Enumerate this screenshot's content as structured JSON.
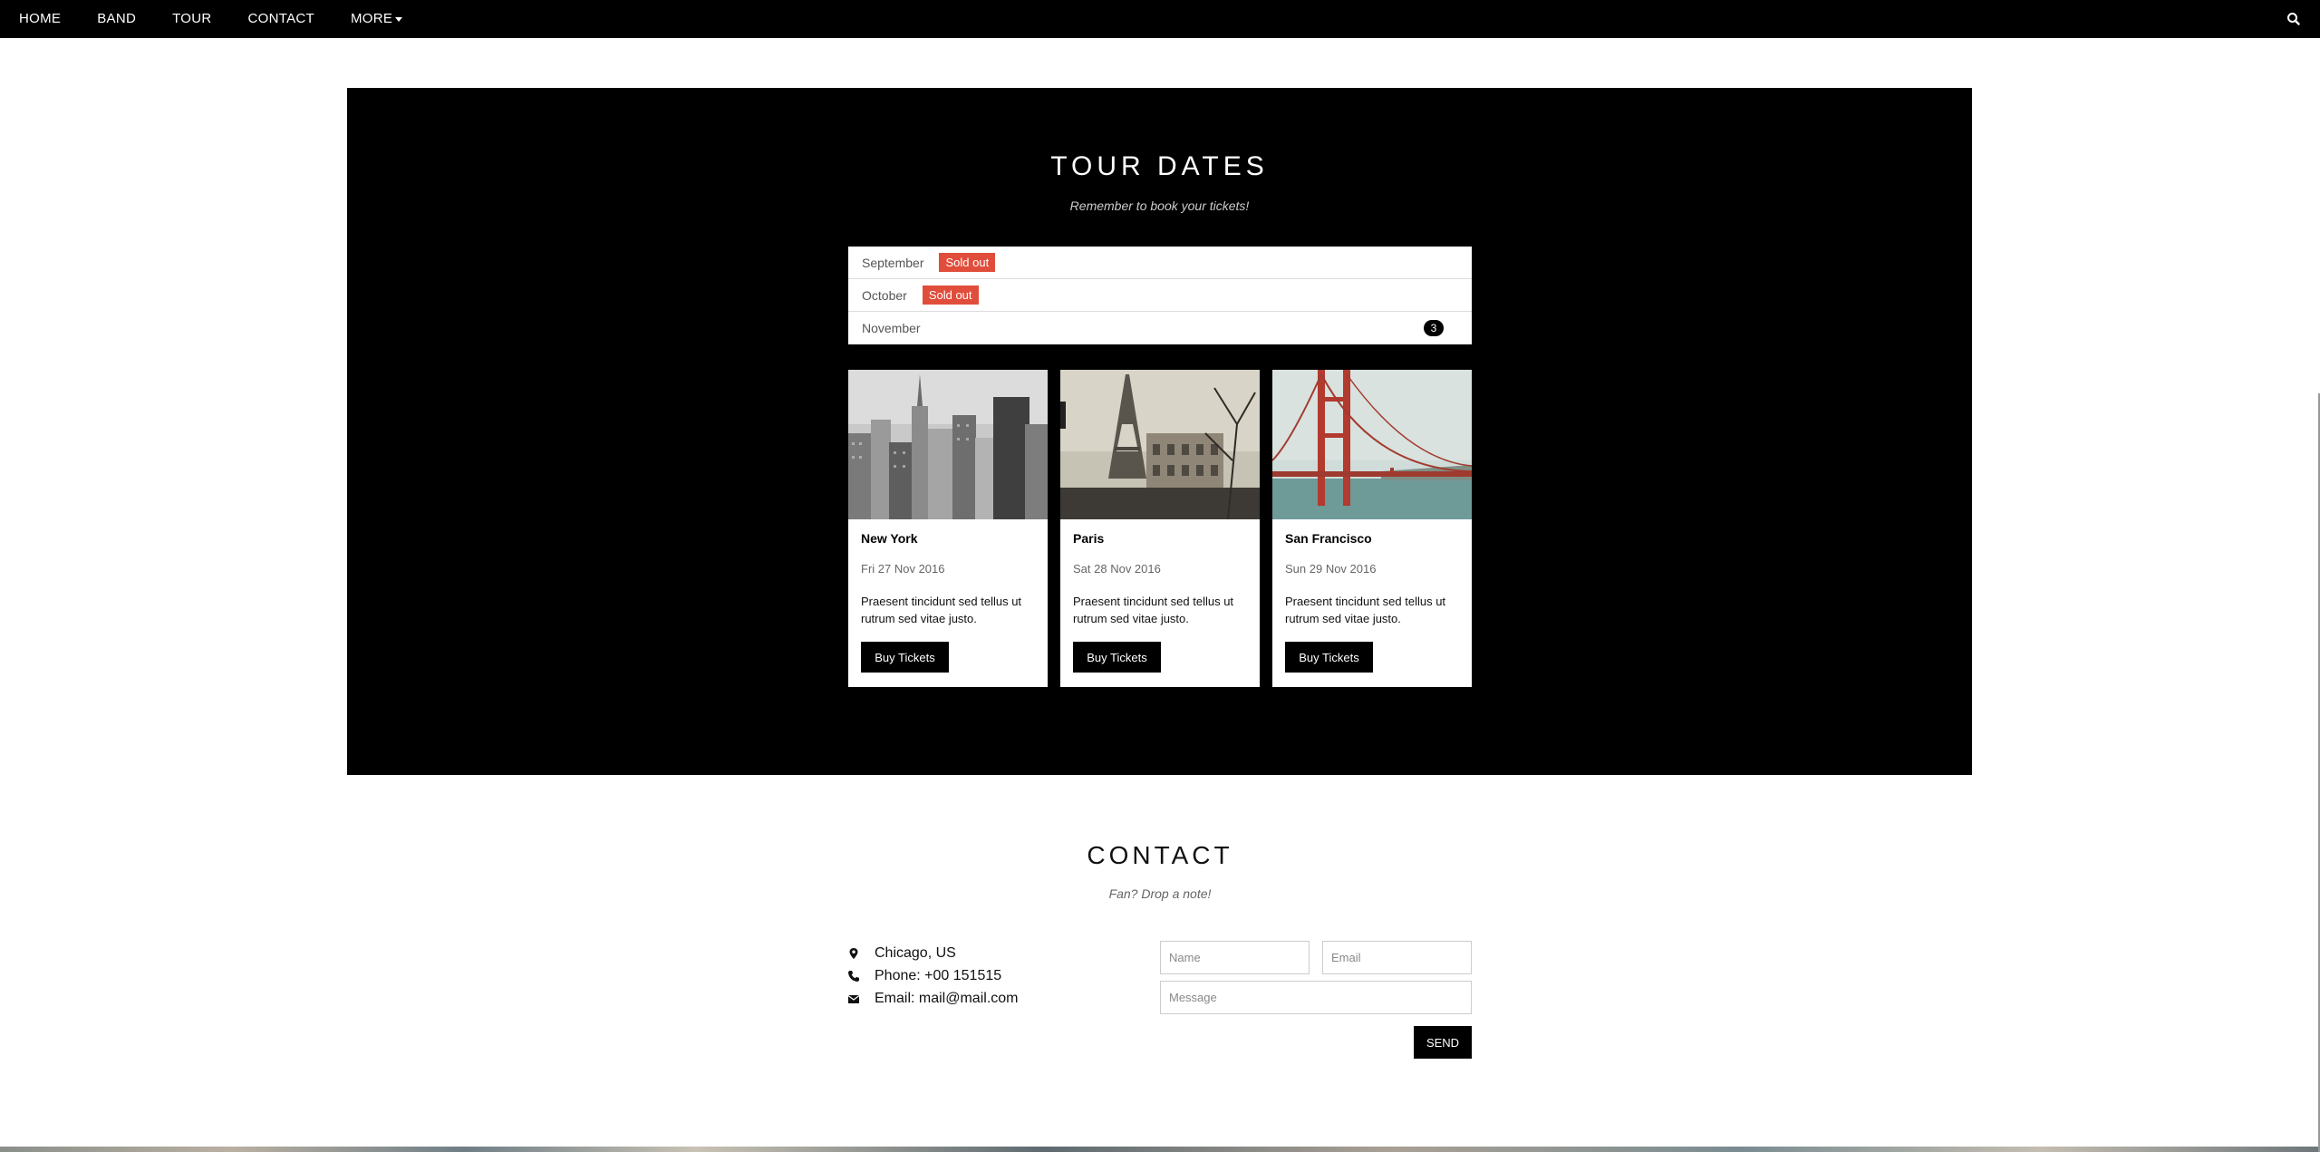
{
  "nav": {
    "items": [
      "HOME",
      "BAND",
      "TOUR",
      "CONTACT"
    ],
    "more_label": "MORE",
    "search_icon": "search-icon"
  },
  "tour": {
    "title": "TOUR DATES",
    "subtitle": "Remember to book your tickets!",
    "months": [
      {
        "name": "September",
        "badge": "Sold out"
      },
      {
        "name": "October",
        "badge": "Sold out"
      },
      {
        "name": "November",
        "count": "3"
      }
    ],
    "cards": [
      {
        "city": "New York",
        "date": "Fri 27 Nov 2016",
        "desc": "Praesent tincidunt sed tellus ut rutrum sed vitae justo.",
        "button": "Buy Tickets"
      },
      {
        "city": "Paris",
        "date": "Sat 28 Nov 2016",
        "desc": "Praesent tincidunt sed tellus ut rutrum sed vitae justo.",
        "button": "Buy Tickets"
      },
      {
        "city": "San Francisco",
        "date": "Sun 29 Nov 2016",
        "desc": "Praesent tincidunt sed tellus ut rutrum sed vitae justo.",
        "button": "Buy Tickets"
      }
    ],
    "colors": {
      "sold_out": "#e04d3b",
      "background": "#000000"
    }
  },
  "contact": {
    "title": "CONTACT",
    "subtitle": "Fan? Drop a note!",
    "location": "Chicago, US",
    "phone": "Phone: +00 151515",
    "email": "Email: mail@mail.com",
    "form": {
      "name_placeholder": "Name",
      "email_placeholder": "Email",
      "message_placeholder": "Message",
      "send_label": "SEND"
    }
  }
}
